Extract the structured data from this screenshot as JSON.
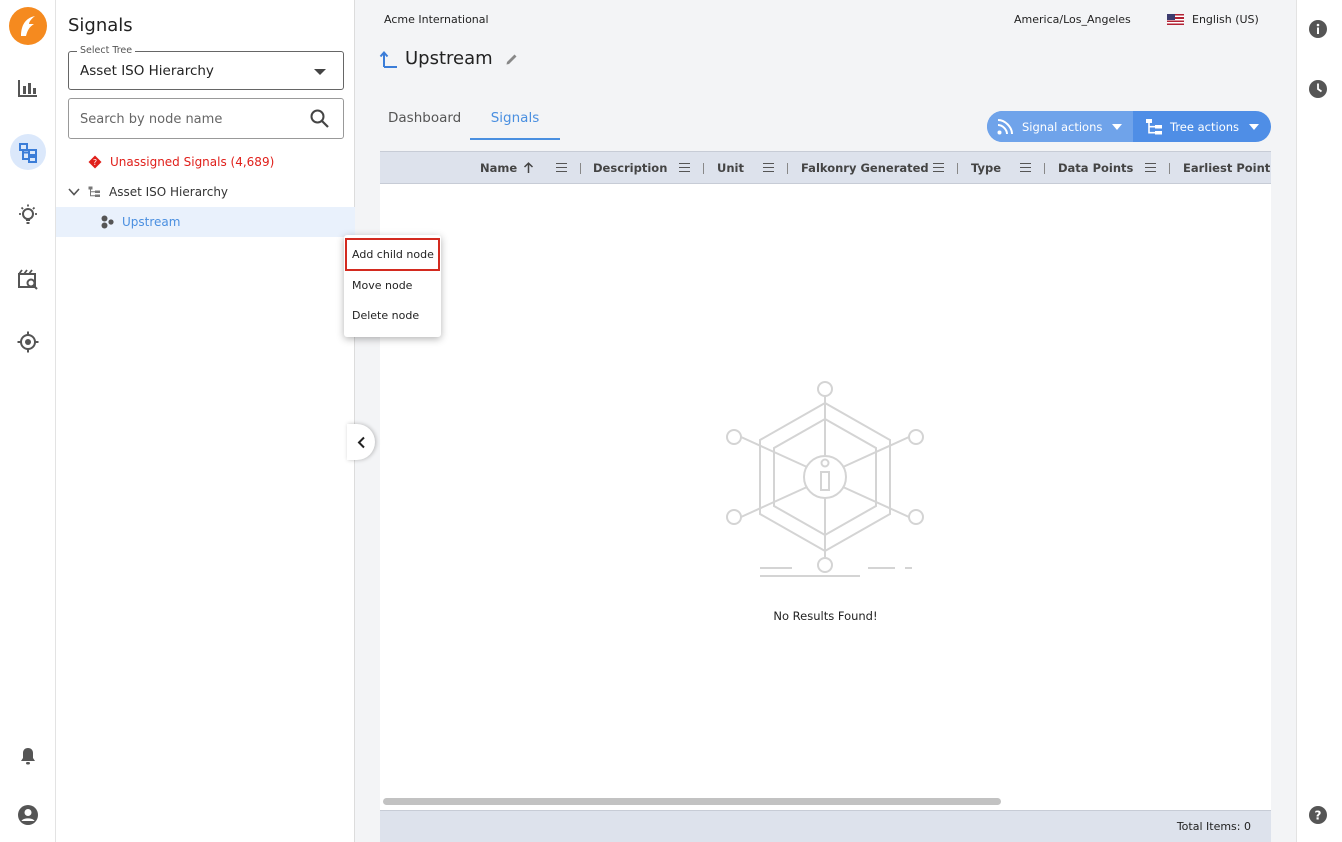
{
  "rail": {
    "icons": [
      "logo-icon",
      "analytics-icon",
      "signals-tree-icon",
      "insights-bulb-icon",
      "event-search-icon",
      "target-icon",
      "notifications-bell-icon",
      "account-icon"
    ]
  },
  "panel": {
    "title": "Signals",
    "select_legend": "Select Tree",
    "select_value": "Asset ISO Hierarchy",
    "search_placeholder": "Search by node name",
    "tree": {
      "unassigned": "Unassigned Signals (4,689)",
      "root": "Asset ISO Hierarchy",
      "child": "Upstream"
    }
  },
  "context_menu": {
    "items": [
      "Add child node",
      "Move node",
      "Delete node"
    ]
  },
  "header": {
    "org": "Acme International",
    "timezone": "America/Los_Angeles",
    "language": "English (US)"
  },
  "page": {
    "title": "Upstream",
    "tabs": [
      "Dashboard",
      "Signals"
    ],
    "active_tab": "Signals",
    "actions": [
      "Signal actions",
      "Tree actions"
    ]
  },
  "grid": {
    "columns": [
      "Name",
      "Description",
      "Unit",
      "Falkonry Generated",
      "Type",
      "Data Points",
      "Earliest Point"
    ],
    "sort_column": "Name",
    "sort_direction": "ascending",
    "empty_text": "No Results Found!",
    "total_label": "Total Items: 0"
  },
  "colors": {
    "brand_orange": "#f58a1f",
    "accent_blue": "#4a8fe0",
    "warning_red": "#e0201b",
    "highlight_border": "#d32a1f"
  }
}
